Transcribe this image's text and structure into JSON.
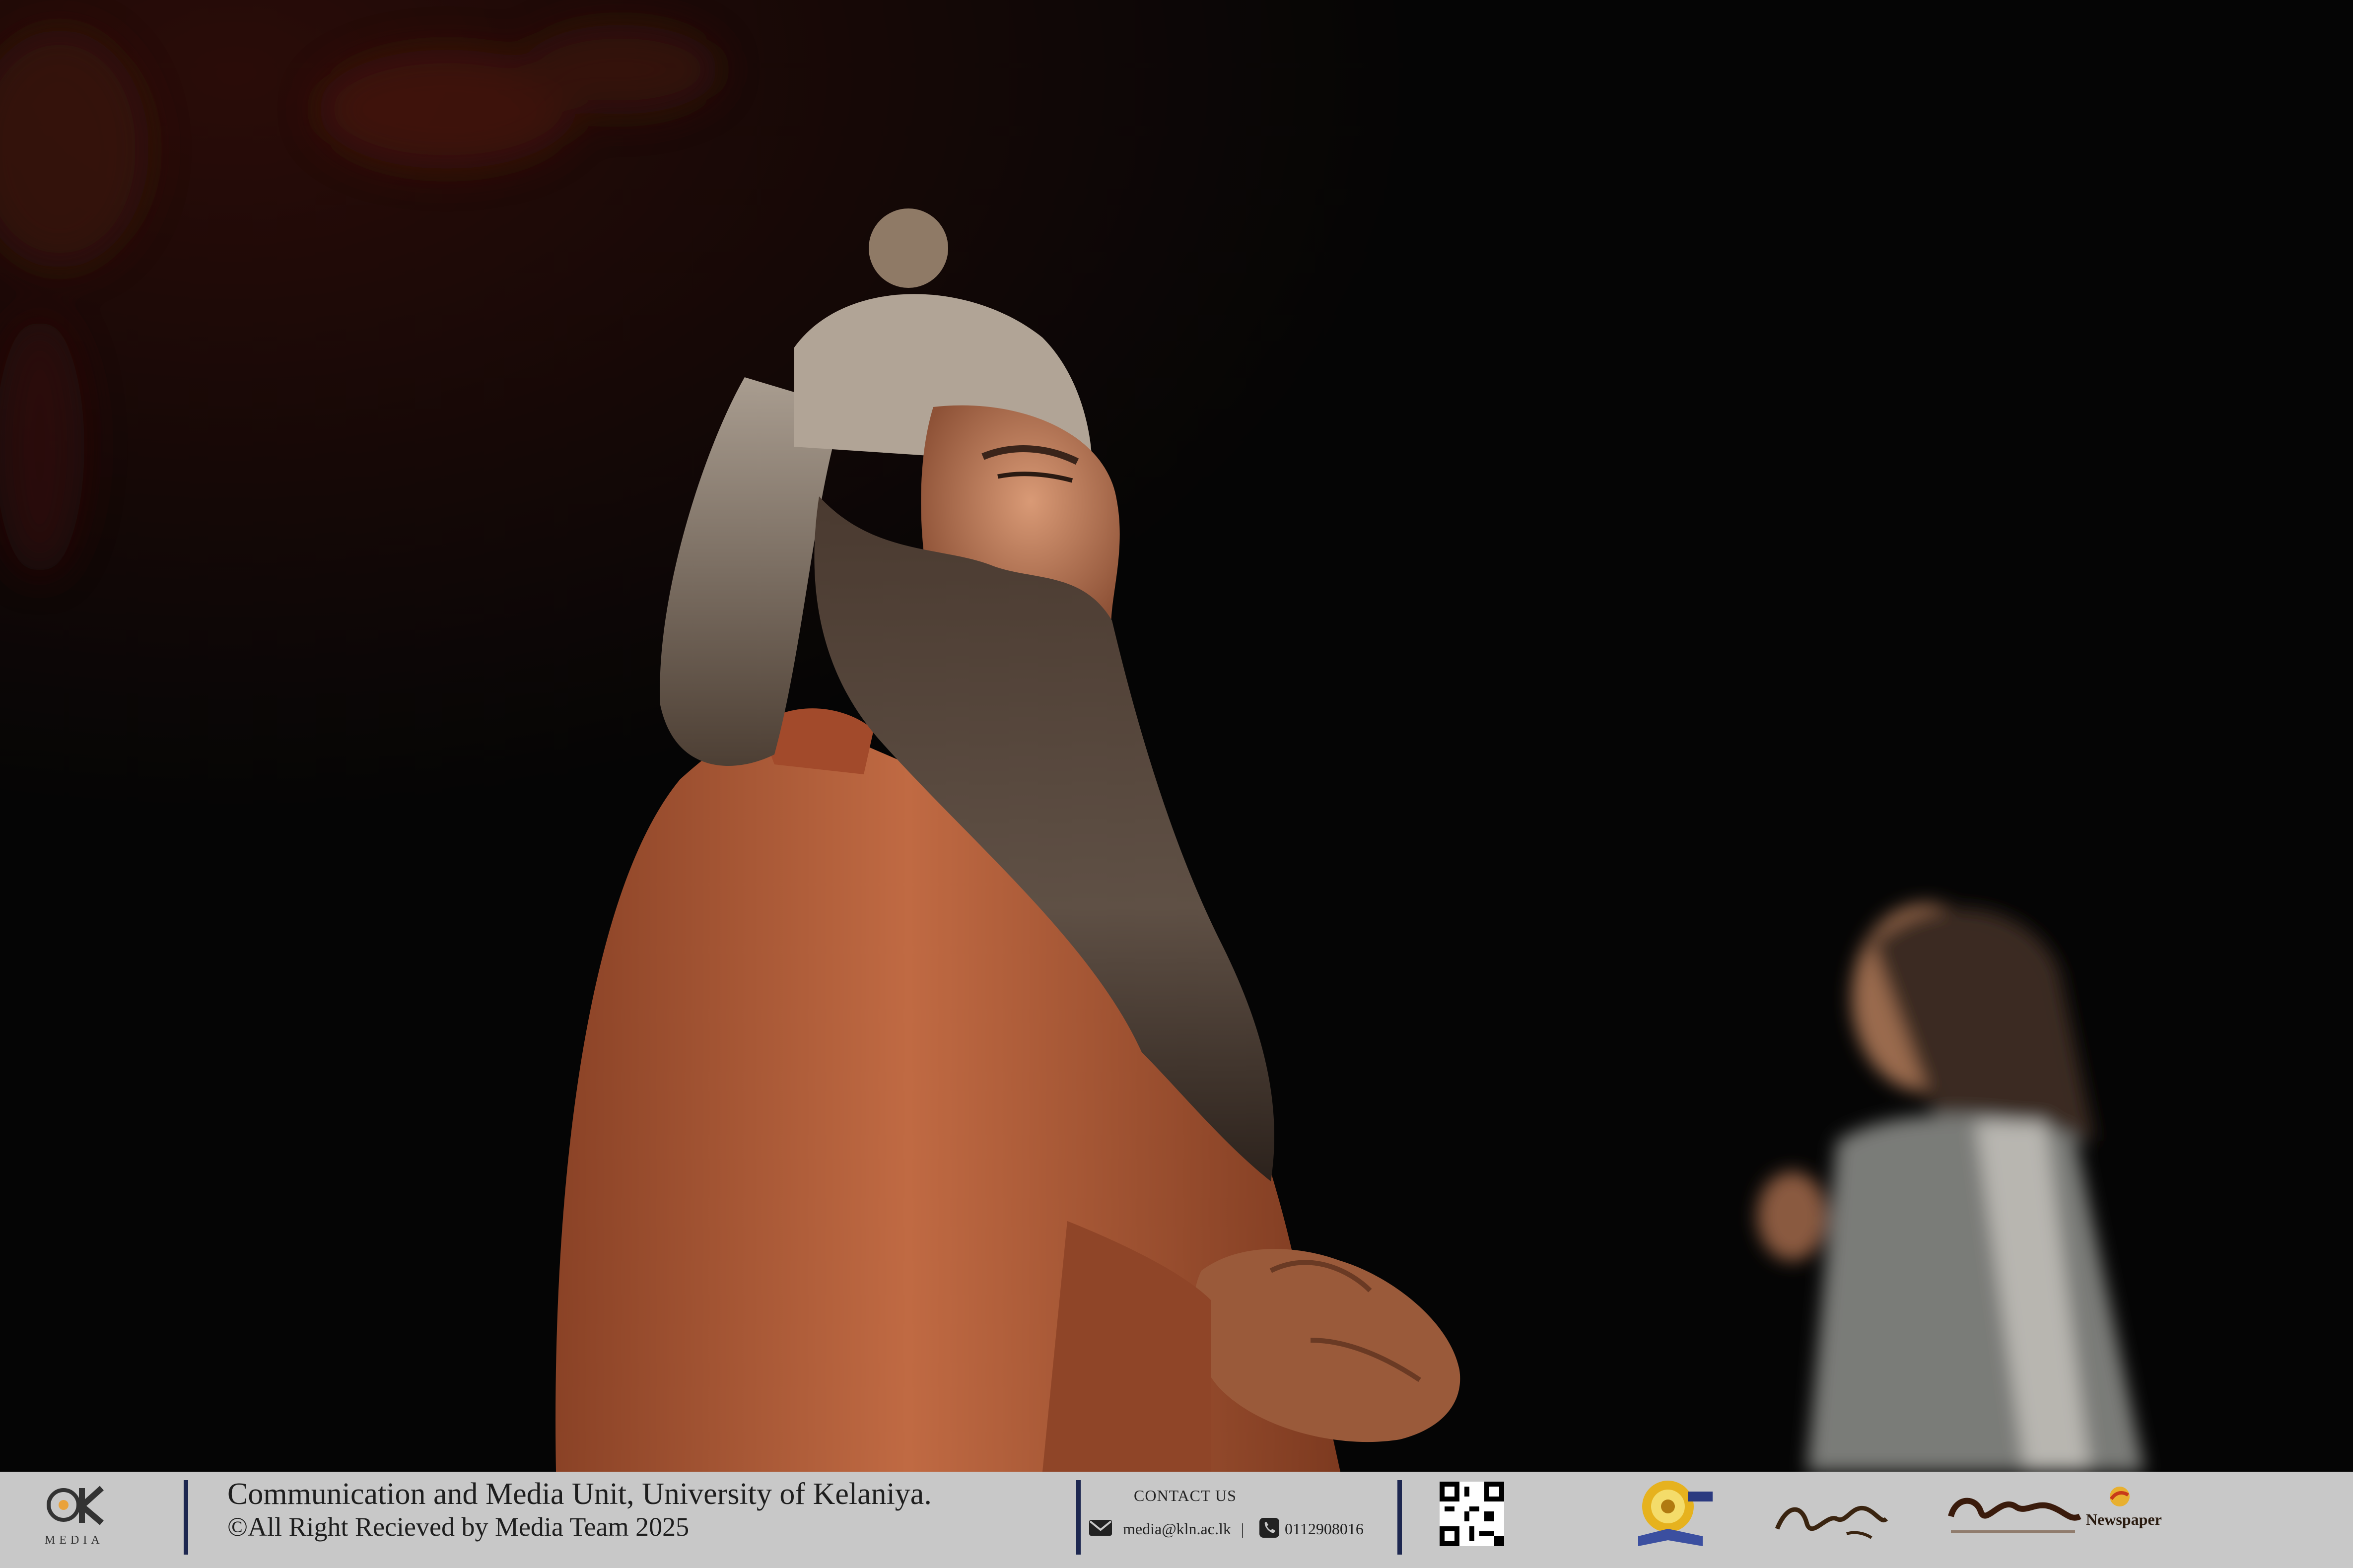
{
  "footer": {
    "logo_letters": "UK",
    "logo_caption": "MEDIA",
    "org_line": "Communication and Media Unit, University of Kelaniya.",
    "copyright_line": "©All Right Recieved by Media Team 2025",
    "contact_heading": "CONTACT US",
    "email": "media@kln.ac.lk",
    "separator": "|",
    "phone": "0112908016",
    "newspaper_label": "Newspaper"
  },
  "colors": {
    "footer_bg": "#c8c8c8",
    "divider": "#1d2750",
    "robe": "#b5603a",
    "background": "#050505"
  }
}
